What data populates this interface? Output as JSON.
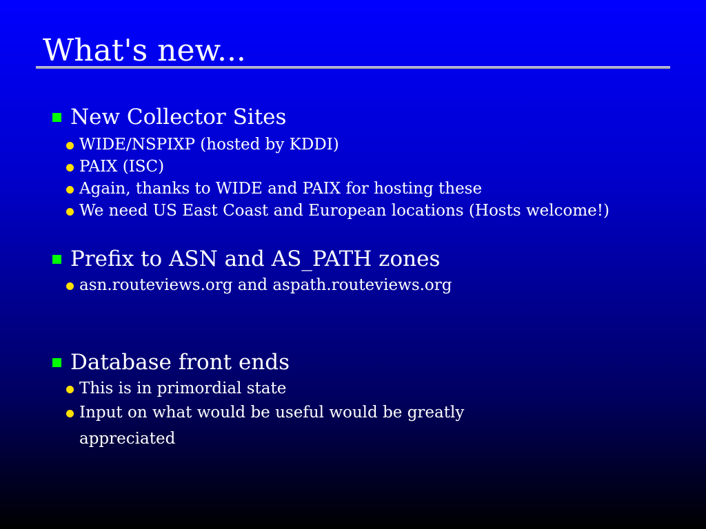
{
  "slide": {
    "title": "What's new...",
    "sections": [
      {
        "heading": "New Collector Sites",
        "bullets": [
          "WIDE/NSPIXP (hosted by KDDI)",
          "PAIX (ISC)",
          "Again, thanks to WIDE and PAIX for hosting these",
          "We need US East Coast and European locations (Hosts welcome!)"
        ]
      },
      {
        "heading": "Prefix to ASN and AS_PATH zones",
        "bullets": [
          "asn.routeviews.org and aspath.routeviews.org"
        ]
      },
      {
        "heading": "Database front ends",
        "bullets": [
          "This is in primordial state",
          "Input on what would be useful would be greatly appreciated"
        ]
      }
    ]
  },
  "colors": {
    "background_top": "#0000ff",
    "background_bottom": "#000000",
    "heading_bullet": "#00ff00",
    "sub_bullet": "#ffe000",
    "text": "#ffffff"
  },
  "icons": {
    "heading_bullet": "green-square-bullet-icon",
    "sub_bullet": "yellow-dot-bullet-icon"
  }
}
